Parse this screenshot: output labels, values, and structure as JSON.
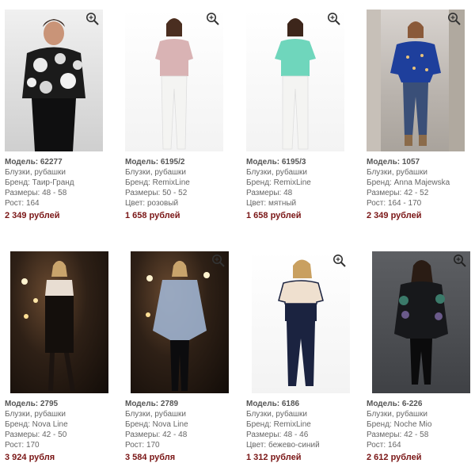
{
  "labels": {
    "model": "Модель:",
    "brand": "Бренд:",
    "sizes": "Размеры:",
    "height": "Рост:",
    "color": "Цвет:"
  },
  "products": [
    {
      "model": "62277",
      "category": "Блузки, рубашки",
      "brand": "Таир-Гранд",
      "sizes": "48 - 58",
      "height": "164",
      "price": "2 349 рублей",
      "image_alt": "Woman in black-white patterned blouse and black trousers"
    },
    {
      "model": "6195/2",
      "category": "Блузки, рубашки",
      "brand": "RemixLine",
      "sizes": "50 - 52",
      "color": "розовый",
      "price": "1 658 рублей",
      "image_alt": "Woman in pink blouse and white trousers"
    },
    {
      "model": "6195/3",
      "category": "Блузки, рубашки",
      "brand": "RemixLine",
      "sizes": "48",
      "color": "мятный",
      "price": "1 658 рублей",
      "image_alt": "Woman in mint blouse and white trousers"
    },
    {
      "model": "1057",
      "category": "Блузки, рубашки",
      "brand": "Anna Majewska",
      "sizes": "42 - 52",
      "height": "164 - 170",
      "price": "2 349 рублей",
      "image_alt": "Woman in blue printed top and jeans"
    },
    {
      "model": "2795",
      "category": "Блузки, рубашки",
      "brand": "Nova Line",
      "sizes": "42 - 50",
      "height": "170",
      "price": "3 924 рубля",
      "image_alt": "Woman in black dress on dark stage"
    },
    {
      "model": "2789",
      "category": "Блузки, рубашки",
      "brand": "Nova Line",
      "sizes": "42 - 48",
      "height": "170",
      "price": "3 584 рубля",
      "image_alt": "Woman in sheer blue cape top and black leggings"
    },
    {
      "model": "6186",
      "category": "Блузки, рубашки",
      "brand": "RemixLine",
      "sizes": "48 - 46",
      "color": "бежево-синий",
      "price": "1 312 рублей",
      "image_alt": "Woman in beige and navy top with navy trousers"
    },
    {
      "model": "6-226",
      "category": "Блузки, рубашки",
      "brand": "Noche Mio",
      "sizes": "42 - 58",
      "height": "164",
      "price": "2 612 рублей",
      "image_alt": "Woman in black printed tunic and black trousers"
    }
  ]
}
